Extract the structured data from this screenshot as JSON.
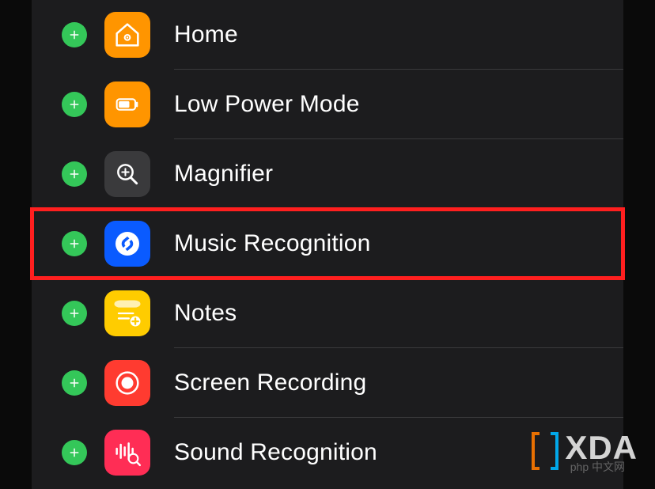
{
  "controls": [
    {
      "key": "home",
      "label": "Home",
      "highlighted": false,
      "iconClass": "ic-home",
      "iconName": "home-icon"
    },
    {
      "key": "lowpower",
      "label": "Low Power Mode",
      "highlighted": false,
      "iconClass": "ic-lowpower",
      "iconName": "battery-icon"
    },
    {
      "key": "magnifier",
      "label": "Magnifier",
      "highlighted": false,
      "iconClass": "ic-magnifier",
      "iconName": "magnifier-icon"
    },
    {
      "key": "music",
      "label": "Music Recognition",
      "highlighted": true,
      "iconClass": "ic-music",
      "iconName": "shazam-icon"
    },
    {
      "key": "notes",
      "label": "Notes",
      "highlighted": false,
      "iconClass": "ic-notes",
      "iconName": "notes-icon"
    },
    {
      "key": "screen",
      "label": "Screen Recording",
      "highlighted": false,
      "iconClass": "ic-screen",
      "iconName": "record-icon"
    },
    {
      "key": "sound",
      "label": "Sound Recognition",
      "highlighted": false,
      "iconClass": "ic-sound",
      "iconName": "soundwave-icon"
    }
  ],
  "watermark": {
    "text": "XDA",
    "subtext": "php 中文网"
  }
}
